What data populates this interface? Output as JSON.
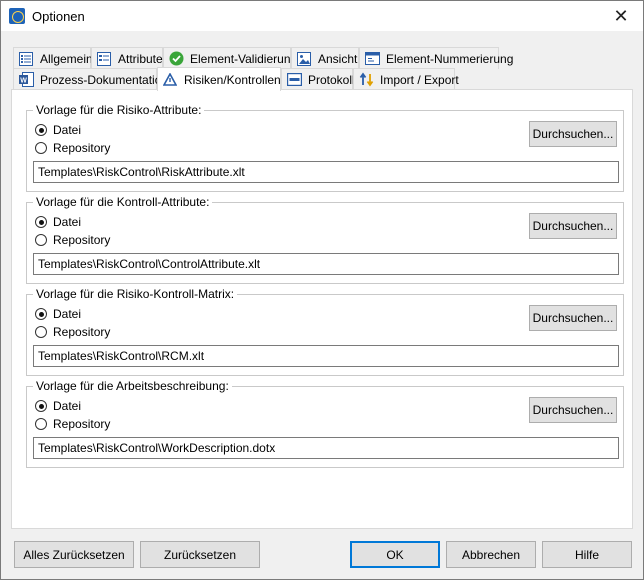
{
  "window": {
    "title": "Optionen",
    "close_glyph": "✕"
  },
  "tabs_row1": [
    {
      "label": "Allgemein",
      "icon": "list-icon"
    },
    {
      "label": "Attribute",
      "icon": "table-icon"
    },
    {
      "label": "Element-Validierung",
      "icon": "check-icon"
    },
    {
      "label": "Ansicht",
      "icon": "image-icon"
    },
    {
      "label": "Element-Nummerierung",
      "icon": "window-icon"
    }
  ],
  "tabs_row2": [
    {
      "label": "Prozess-Dokumentation",
      "icon": "word-doc-icon"
    },
    {
      "label": "Risiken/Kontrollen",
      "icon": "warning-triangle-icon",
      "active": true
    },
    {
      "label": "Protokoll",
      "icon": "log-icon"
    },
    {
      "label": "Import / Export",
      "icon": "import-export-icon"
    }
  ],
  "groups": [
    {
      "legend": "Vorlage für die Risiko-Attribute:",
      "option_file": "Datei",
      "option_repo": "Repository",
      "selected": "Datei",
      "browse_label": "Durchsuchen...",
      "path": "Templates\\RiskControl\\RiskAttribute.xlt"
    },
    {
      "legend": "Vorlage für die Kontroll-Attribute:",
      "option_file": "Datei",
      "option_repo": "Repository",
      "selected": "Datei",
      "browse_label": "Durchsuchen...",
      "path": "Templates\\RiskControl\\ControlAttribute.xlt"
    },
    {
      "legend": "Vorlage für die Risiko-Kontroll-Matrix:",
      "option_file": "Datei",
      "option_repo": "Repository",
      "selected": "Datei",
      "browse_label": "Durchsuchen...",
      "path": "Templates\\RiskControl\\RCM.xlt"
    },
    {
      "legend": "Vorlage für die Arbeitsbeschreibung:",
      "option_file": "Datei",
      "option_repo": "Repository",
      "selected": "Datei",
      "browse_label": "Durchsuchen...",
      "path": "Templates\\RiskControl\\WorkDescription.dotx"
    }
  ],
  "footer": {
    "reset_all": "Alles Zurücksetzen",
    "reset": "Zurücksetzen",
    "ok": "OK",
    "cancel": "Abbrechen",
    "help": "Hilfe"
  },
  "colors": {
    "accent": "#0078d7",
    "panel_bg": "#ffffff",
    "dialog_bg": "#f0f0f0"
  }
}
